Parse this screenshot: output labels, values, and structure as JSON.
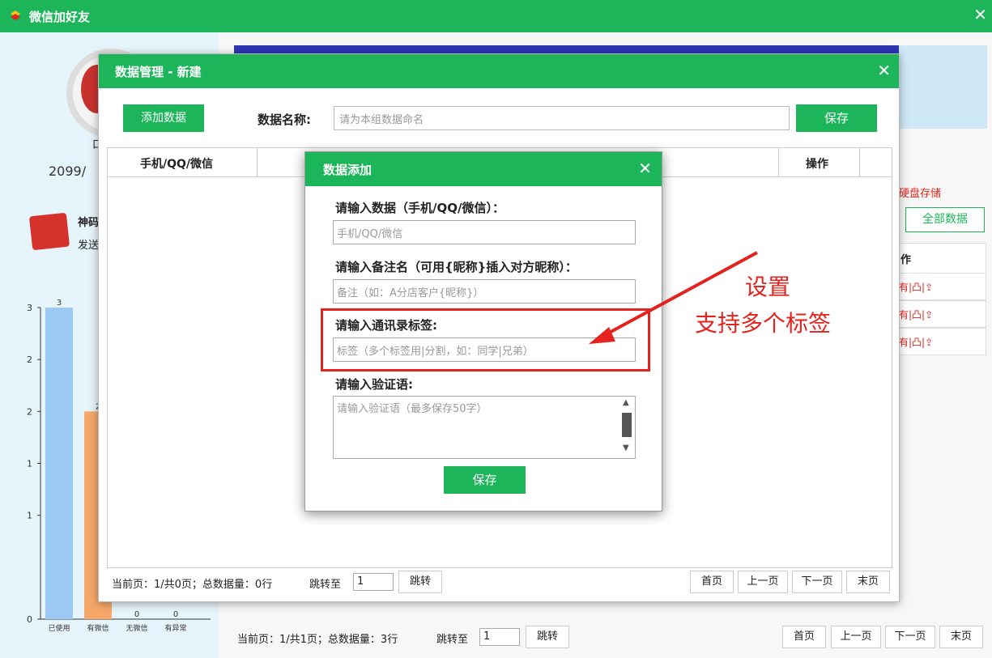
{
  "window": {
    "title": "微信加好友",
    "close_glyph": "✕"
  },
  "left": {
    "mark": "口",
    "date": "2099/",
    "brand_name": "神码",
    "brand_sub": "发送"
  },
  "background": {
    "hdd_text": "硬盘存储",
    "all_data_label": "全部数据",
    "op_header": "作",
    "row_actions": [
      "有|凸|⇪",
      "有|凸|⇪",
      "有|凸|⇪"
    ],
    "pager": {
      "status": "当前页：1/共1页；总数据量：3行",
      "jump_label": "跳转至",
      "jump_value": "1",
      "jump_button": "跳转",
      "first": "首页",
      "prev": "上一页",
      "next": "下一页",
      "last": "末页"
    }
  },
  "chart_data": {
    "type": "bar",
    "categories": [
      "已使用",
      "有微信",
      "无微信",
      "有异常"
    ],
    "values": [
      3,
      2,
      0,
      0
    ],
    "bar_labels": [
      "3",
      "2",
      "0",
      "0"
    ],
    "yticks": [
      "0",
      "1",
      "1",
      "2",
      "2",
      "3"
    ],
    "colors": [
      "#9ccaf5",
      "#f5a86a",
      "#62cfa0",
      "#b8b8b8"
    ],
    "ylim": [
      0,
      3
    ]
  },
  "dialog_manage": {
    "title": "数据管理 - 新建",
    "add_button": "添加数据",
    "name_label": "数据名称:",
    "name_placeholder": "请为本组数据命名",
    "save_button": "保存",
    "col_contact": "手机/QQ/微信",
    "col_op": "操作",
    "pager": {
      "status": "当前页：1/共0页；总数据量：0行",
      "jump_label": "跳转至",
      "jump_value": "1",
      "jump_button": "跳转",
      "first": "首页",
      "prev": "上一页",
      "next": "下一页",
      "last": "末页"
    }
  },
  "dialog_add": {
    "title": "数据添加",
    "field_data_label": "请输入数据（手机/QQ/微信）：",
    "field_data_placeholder": "手机/QQ/微信",
    "field_remark_label": "请输入备注名（可用{昵称}插入对方昵称）：",
    "field_remark_placeholder": "备注（如：A分店客户{昵称}）",
    "field_tag_label": "请输入通讯录标签:",
    "field_tag_placeholder": "标签（多个标签用|分割，如：同学|兄弟）",
    "field_verify_label": "请输入验证语:",
    "field_verify_placeholder": "请输入验证语（最多保存50字）",
    "save_button": "保存"
  },
  "annotation": {
    "line1": "设置",
    "line2": "支持多个标签",
    "color": "#e4221e"
  },
  "colors": {
    "accent": "#1cb55a"
  }
}
